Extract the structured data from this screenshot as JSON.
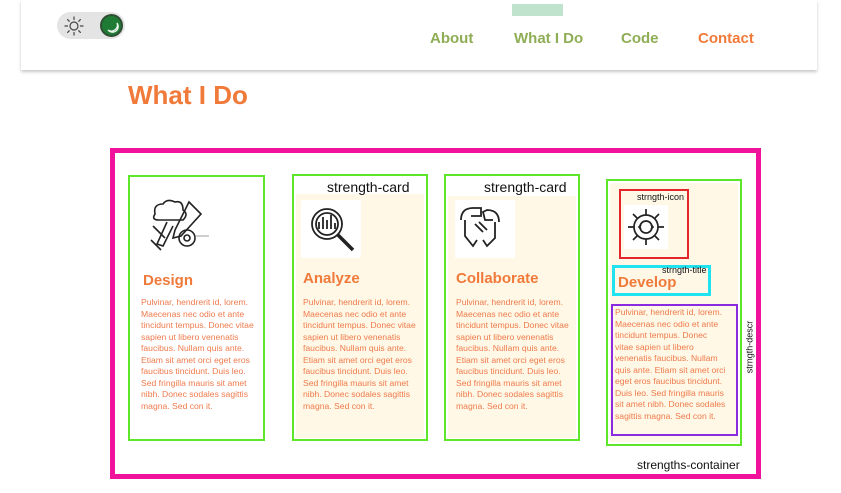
{
  "header": {
    "theme_toggle": {
      "state": "dark",
      "sun_icon": "sun-icon",
      "knob_icon": "moon-icon"
    },
    "nav": [
      {
        "label": "About"
      },
      {
        "label": "What I Do",
        "active": true
      },
      {
        "label": "Code"
      },
      {
        "label": "Contact",
        "accent": true
      }
    ],
    "colors": {
      "nav": "#8fad55",
      "accent": "#f07a3a",
      "active_indicator": "#bfe3cc"
    }
  },
  "page_title": "What I Do",
  "strengths": {
    "container_label": "strengths-container",
    "card_label": "strength-card",
    "icon_label": "strngth-icon",
    "title_label": "strngth-title",
    "descr_label": "strngth-descr",
    "cards": [
      {
        "title": "Design",
        "icon": "design-tools-icon",
        "description": "Pulvinar, hendrerit id, lorem. Maecenas nec odio et ante tincidunt tempus. Donec vitae sapien ut libero venenatis faucibus. Nullam quis ante. Etiam sit amet orci eget eros faucibus tincidunt. Duis leo. Sed fringilla mauris sit amet nibh. Donec sodales sagittis magna. Sed con it."
      },
      {
        "title": "Analyze",
        "icon": "analyze-magnifier-icon",
        "description": "Pulvinar, hendrerit id, lorem. Maecenas nec odio et ante tincidunt tempus. Donec vitae sapien ut libero venenatis faucibus. Nullam quis ante. Etiam sit amet orci eget eros faucibus tincidunt. Duis leo. Sed fringilla mauris sit amet nibh. Donec sodales sagittis magna. Sed con it."
      },
      {
        "title": "Collaborate",
        "icon": "collaborate-hands-icon",
        "description": "Pulvinar, hendrerit id, lorem. Maecenas nec odio et ante tincidunt tempus. Donec vitae sapien ut libero venenatis faucibus. Nullam quis ante. Etiam sit amet orci eget eros faucibus tincidunt. Duis leo. Sed fringilla mauris sit amet nibh. Donec sodales sagittis magna. Sed con it."
      },
      {
        "title": "Develop",
        "icon": "develop-gear-icon",
        "description": "Pulvinar, hendrerit id, lorem. Maecenas nec odio et ante tincidunt tempus. Donec vitae sapien ut libero venenatis faucibus. Nullam quis ante. Etiam sit amet orci eget eros faucibus tincidunt. Duis leo. Sed fringilla mauris sit amet nibh. Donec sodales sagittis magna. Sed con it."
      }
    ],
    "colors": {
      "container_outline": "#f0129a",
      "card_outline": "#5ee629",
      "card_bg": "#fff8e6",
      "icon_outline": "#e3242b",
      "title_outline": "#1fe3f0",
      "descr_outline": "#8a2be2"
    }
  }
}
